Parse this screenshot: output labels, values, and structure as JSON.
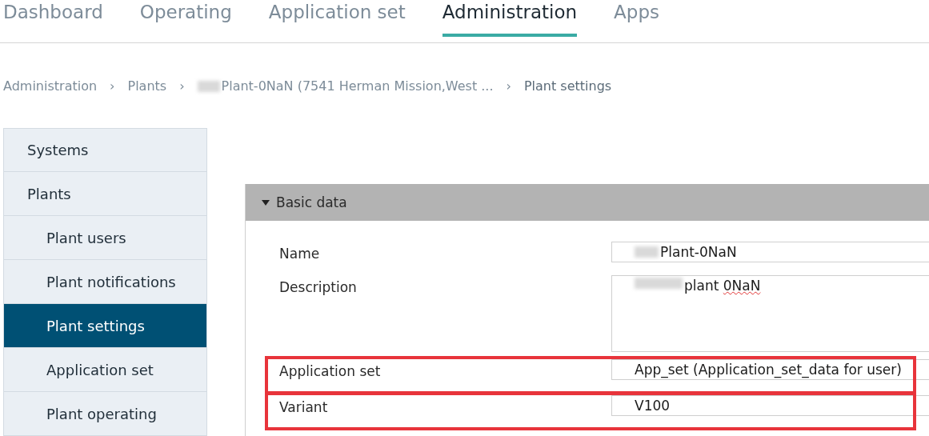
{
  "tabs": [
    {
      "label": "Dashboard",
      "selected": false
    },
    {
      "label": "Operating",
      "selected": false
    },
    {
      "label": "Application set",
      "selected": false
    },
    {
      "label": "Administration",
      "selected": true
    },
    {
      "label": "Apps",
      "selected": false
    }
  ],
  "breadcrumb": [
    {
      "text": "Administration",
      "blurred_prefix": false
    },
    {
      "separator": "›",
      "text": "Plants",
      "blurred_prefix": false
    },
    {
      "separator": "›",
      "text": "Plant-0NaN (7541 Herman Mission,West ...",
      "blurred_prefix": true
    },
    {
      "separator": "›",
      "text": "Plant settings",
      "blurred_prefix": false
    }
  ],
  "sidebar": {
    "items": [
      {
        "label": "Systems",
        "selected": false
      },
      {
        "label": "Plants",
        "selected": false,
        "children": [
          {
            "label": "Plant users",
            "selected": false
          },
          {
            "label": "Plant notifications",
            "selected": false
          },
          {
            "label": "Plant settings",
            "selected": true
          },
          {
            "label": "Application set",
            "selected": false
          },
          {
            "label": "Plant operating",
            "selected": false
          }
        ]
      }
    ]
  },
  "panel": {
    "title": "Basic data",
    "expanded": true,
    "fields": [
      {
        "label": "Name",
        "kind": "input",
        "blurred_prefix": true,
        "highlighted": false,
        "value_parts": [
          {
            "text": "Plant-0NaN",
            "misspelled": false
          }
        ]
      },
      {
        "label": "Description",
        "kind": "textarea",
        "blurred_prefix": true,
        "highlighted": false,
        "value_parts": [
          {
            "text": "plant ",
            "misspelled": false
          },
          {
            "text": "0NaN",
            "misspelled": true
          }
        ]
      },
      {
        "label": "Application set",
        "kind": "input",
        "blurred_prefix": false,
        "highlighted": true,
        "value_parts": [
          {
            "text": "App_set (Application_set_data for user)",
            "misspelled": false
          }
        ]
      },
      {
        "label": "Variant",
        "kind": "input",
        "blurred_prefix": false,
        "highlighted": true,
        "value_parts": [
          {
            "text": "V100",
            "misspelled": false
          }
        ]
      }
    ]
  }
}
